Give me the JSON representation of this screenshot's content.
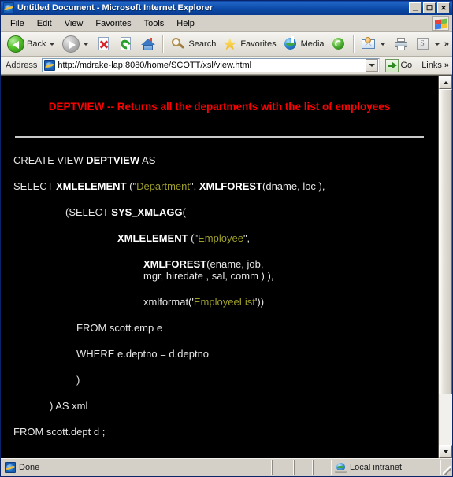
{
  "window": {
    "title": "Untitled Document - Microsoft Internet Explorer",
    "minimize_label": "_",
    "maximize_label": "☐",
    "close_label": "✕"
  },
  "menu": {
    "items": [
      {
        "label": "File"
      },
      {
        "label": "Edit"
      },
      {
        "label": "View"
      },
      {
        "label": "Favorites"
      },
      {
        "label": "Tools"
      },
      {
        "label": "Help"
      }
    ]
  },
  "toolbar": {
    "back_label": "Back",
    "search_label": "Search",
    "favorites_label": "Favorites",
    "media_label": "Media",
    "overflow_label": "»",
    "icons": {
      "back": "back-arrow-icon",
      "forward": "forward-arrow-icon",
      "stop": "stop-icon",
      "refresh": "refresh-icon",
      "home": "home-icon",
      "search": "search-icon",
      "favorites": "star-icon",
      "media": "media-globe-icon",
      "history": "history-icon",
      "mail": "mail-icon",
      "print": "print-icon",
      "edit": "edit-page-icon"
    }
  },
  "address": {
    "label": "Address",
    "url": "http://mdrake-lap:8080/home/SCOTT/xsl/view.html",
    "go_label": "Go",
    "links_label": "Links",
    "links_overflow": "»"
  },
  "document": {
    "heading": "DEPTVIEW -- Returns all the departments with the list of employees",
    "sql_lines": [
      {
        "indent": "i1",
        "parts": [
          {
            "t": "CREATE VIEW ",
            "s": "plain"
          },
          {
            "t": "DEPTVIEW",
            "s": "kw"
          },
          {
            "t": " AS",
            "s": "plain"
          }
        ]
      },
      {
        "indent": "i1",
        "parts": [
          {
            "t": "SELECT ",
            "s": "plain"
          },
          {
            "t": "XMLELEMENT",
            "s": "kw"
          },
          {
            "t": " (\"",
            "s": "plain"
          },
          {
            "t": "Department",
            "s": "str"
          },
          {
            "t": "\", ",
            "s": "plain"
          },
          {
            "t": "XMLFOREST",
            "s": "kw"
          },
          {
            "t": "(dname, loc ),",
            "s": "plain"
          }
        ]
      },
      {
        "indent": "i2",
        "parts": [
          {
            "t": "(SELECT ",
            "s": "plain"
          },
          {
            "t": "SYS_XMLAGG",
            "s": "kw"
          },
          {
            "t": "(",
            "s": "plain"
          }
        ]
      },
      {
        "indent": "i3",
        "parts": [
          {
            "t": "XMLELEMENT",
            "s": "kw"
          },
          {
            "t": " (\"",
            "s": "plain"
          },
          {
            "t": "Employee",
            "s": "str"
          },
          {
            "t": "\",",
            "s": "plain"
          }
        ]
      },
      {
        "indent": "i4",
        "tight": true,
        "parts": [
          {
            "t": "XMLFOREST",
            "s": "kw"
          },
          {
            "t": "(ename, job,",
            "s": "plain"
          }
        ]
      },
      {
        "indent": "i5",
        "tight2": true,
        "parts": [
          {
            "t": "mgr, hiredate , sal, comm ) ),",
            "s": "plain"
          }
        ]
      },
      {
        "indent": "i5",
        "parts": [
          {
            "t": "xmlformat('",
            "s": "plain"
          },
          {
            "t": "EmployeeList",
            "s": "str"
          },
          {
            "t": "'))",
            "s": "plain"
          }
        ]
      },
      {
        "indent": "i6",
        "parts": [
          {
            "t": "FROM scott.emp e",
            "s": "plain"
          }
        ]
      },
      {
        "indent": "i6",
        "parts": [
          {
            "t": "WHERE e.deptno = d.deptno",
            "s": "plain"
          }
        ]
      },
      {
        "indent": "i6",
        "parts": [
          {
            "t": ")",
            "s": "plain"
          }
        ]
      },
      {
        "indent": "i7",
        "parts": [
          {
            "t": ") AS xml",
            "s": "plain"
          }
        ]
      },
      {
        "indent": "i1",
        "parts": [
          {
            "t": "FROM scott.dept d ;",
            "s": "plain"
          }
        ]
      }
    ]
  },
  "statusbar": {
    "status": "Done",
    "zone": "Local intranet"
  },
  "colors": {
    "page_background": "#000000",
    "heading": "#ff0000",
    "body_text": "#e6e6e6",
    "string_literal": "#9e9e2a",
    "rule": "#c9c9c9",
    "titlebar": "#0c4ba8",
    "chrome": "#d4d0c8"
  }
}
